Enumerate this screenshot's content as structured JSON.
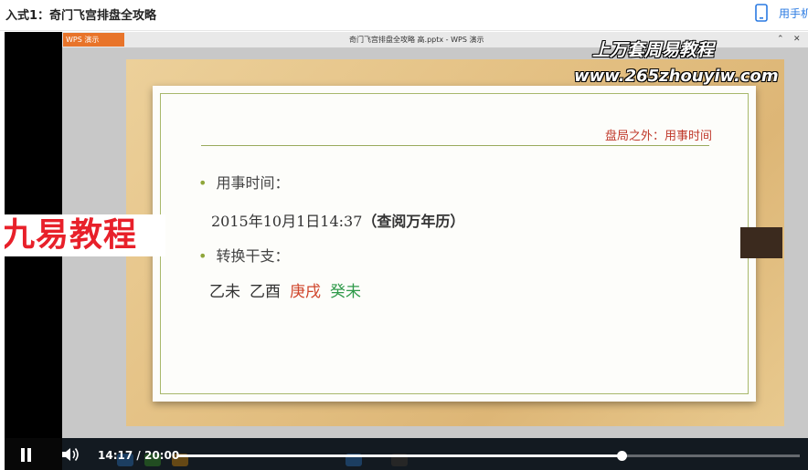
{
  "header": {
    "title": "入式1：奇门飞宫排盘全攻略",
    "mobile_label": "用手机"
  },
  "wps": {
    "app_label": "WPS 演示",
    "doc_title": "奇门飞宫排盘全攻略 高.pptx - WPS 演示"
  },
  "watermark": {
    "line1": "上万套周易教程",
    "line2": "www.265zhouyiw.com"
  },
  "logo": {
    "text": "九易教程"
  },
  "slide": {
    "header_title": "盘局之外：用事时间",
    "bullet1": "用事时间：",
    "datetime": "2015年10月1日14:37",
    "datetime_note": "（查阅万年历）",
    "bullet2": "转换干支：",
    "ganzhi": [
      {
        "text": "乙未",
        "color": "#333333"
      },
      {
        "text": "乙酉",
        "color": "#333333"
      },
      {
        "text": "庚戌",
        "color": "#d0452b"
      },
      {
        "text": "癸未",
        "color": "#2f9a4a"
      }
    ]
  },
  "player": {
    "current_time": "14:17",
    "separator": "/",
    "duration": "20:00",
    "progress": 0.7135
  }
}
